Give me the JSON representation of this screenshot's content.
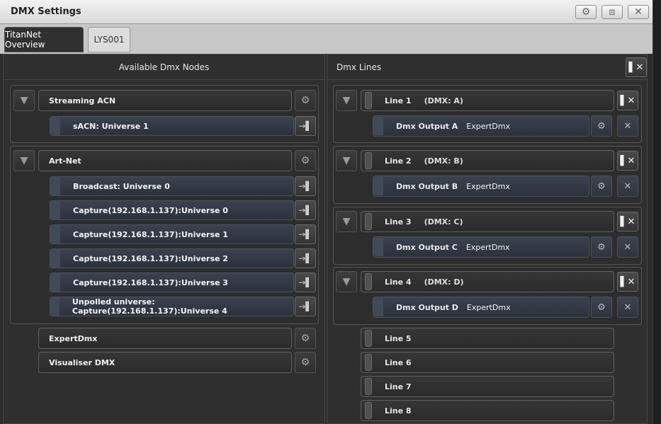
{
  "window": {
    "title": "DMX Settings",
    "buttons": [
      "⚙",
      "⧈",
      "✕"
    ]
  },
  "tabs": [
    {
      "label": "TitanNet Overview",
      "active": true
    },
    {
      "label": "LYS001",
      "active": false
    }
  ],
  "left_panel": {
    "header": "Available Dmx Nodes",
    "groups": [
      {
        "label": "Streaming ACN",
        "items": [
          "sACN: Universe 1"
        ]
      },
      {
        "label": "Art-Net",
        "items": [
          "Broadcast: Universe 0",
          "Capture(192.168.1.137):Universe 0",
          "Capture(192.168.1.137):Universe 1",
          "Capture(192.168.1.137):Universe 2",
          "Capture(192.168.1.137):Universe 3",
          "Unpolled universe: Capture(192.168.1.137):Universe 4"
        ]
      }
    ],
    "standalone": [
      "ExpertDmx",
      "Visualiser DMX"
    ]
  },
  "right_panel": {
    "header": "Dmx Lines",
    "lines": [
      {
        "label": "Line 1",
        "dmx": "(DMX: A)",
        "output": "Dmx Output A",
        "type": "ExpertDmx"
      },
      {
        "label": "Line 2",
        "dmx": "(DMX: B)",
        "output": "Dmx Output B",
        "type": "ExpertDmx"
      },
      {
        "label": "Line 3",
        "dmx": "(DMX: C)",
        "output": "Dmx Output C",
        "type": "ExpertDmx"
      },
      {
        "label": "Line 4",
        "dmx": "(DMX: D)",
        "output": "Dmx Output D",
        "type": "ExpertDmx"
      }
    ],
    "empty_lines": [
      "Line 5",
      "Line 6",
      "Line 7",
      "Line 8"
    ]
  },
  "icons": {
    "gear": "⚙",
    "triangle": "▼",
    "close": "✕",
    "plug": "→▌",
    "boxx": "▌✕"
  },
  "colors": {
    "accent": "#3a4250",
    "window_bg": "#2b2b2b",
    "tab_active": "#303030",
    "tab_inactive": "#dcdcdc"
  }
}
